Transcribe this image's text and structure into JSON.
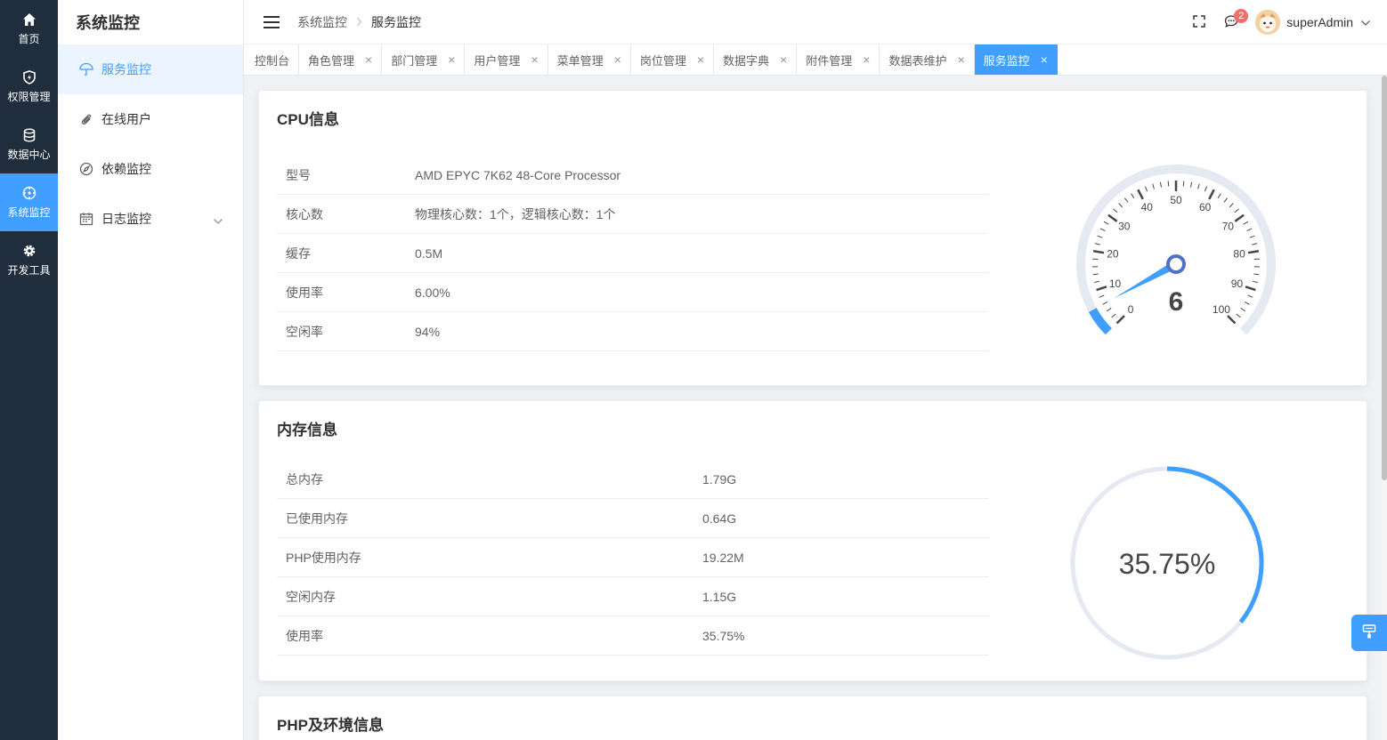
{
  "rail": [
    {
      "label": "首页",
      "icon": "home-icon"
    },
    {
      "label": "权限管理",
      "icon": "shield-icon"
    },
    {
      "label": "数据中心",
      "icon": "database-icon"
    },
    {
      "label": "系统监控",
      "icon": "monitor-icon",
      "active": true
    },
    {
      "label": "开发工具",
      "icon": "gear-icon"
    }
  ],
  "submenu": {
    "title": "系统监控",
    "items": [
      {
        "label": "服务监控",
        "icon": "umbrella-icon",
        "active": true
      },
      {
        "label": "在线用户",
        "icon": "paperclip-icon"
      },
      {
        "label": "依赖监控",
        "icon": "compass-icon"
      },
      {
        "label": "日志监控",
        "icon": "calendar-icon",
        "has_children": true
      }
    ]
  },
  "header": {
    "breadcrumb": [
      "系统监控",
      "服务监控"
    ],
    "notification_count": "2",
    "username": "superAdmin"
  },
  "tags": [
    {
      "label": "控制台",
      "closable": false
    },
    {
      "label": "角色管理",
      "closable": true
    },
    {
      "label": "部门管理",
      "closable": true
    },
    {
      "label": "用户管理",
      "closable": true
    },
    {
      "label": "菜单管理",
      "closable": true
    },
    {
      "label": "岗位管理",
      "closable": true
    },
    {
      "label": "数据字典",
      "closable": true
    },
    {
      "label": "附件管理",
      "closable": true
    },
    {
      "label": "数据表维护",
      "closable": true
    },
    {
      "label": "服务监控",
      "closable": true,
      "active": true
    }
  ],
  "cpu": {
    "title": "CPU信息",
    "rows": [
      {
        "key": "型号",
        "value": "AMD EPYC 7K62 48-Core Processor"
      },
      {
        "key": "核心数",
        "value": "物理核心数：1个，逻辑核心数：1个"
      },
      {
        "key": "缓存",
        "value": "0.5M"
      },
      {
        "key": "使用率",
        "value": "6.00%"
      },
      {
        "key": "空闲率",
        "value": "94%"
      }
    ],
    "gauge": {
      "value": 6,
      "display": "6",
      "min": 0,
      "max": 100,
      "ticks": [
        "0",
        "10",
        "20",
        "30",
        "40",
        "50",
        "60",
        "70",
        "80",
        "90",
        "100"
      ]
    }
  },
  "memory": {
    "title": "内存信息",
    "rows": [
      {
        "key": "总内存",
        "value": "1.79G"
      },
      {
        "key": "已使用内存",
        "value": "0.64G"
      },
      {
        "key": "PHP使用内存",
        "value": "19.22M"
      },
      {
        "key": "空闲内存",
        "value": "1.15G"
      },
      {
        "key": "使用率",
        "value": "35.75%"
      }
    ],
    "ring": {
      "value": 35.75,
      "display": "35.75%"
    }
  },
  "php": {
    "title": "PHP及环境信息"
  },
  "colors": {
    "accent": "#409eff",
    "rail_bg": "#1f2d3d",
    "track": "#e4e9f2",
    "danger": "#f56c6c"
  }
}
